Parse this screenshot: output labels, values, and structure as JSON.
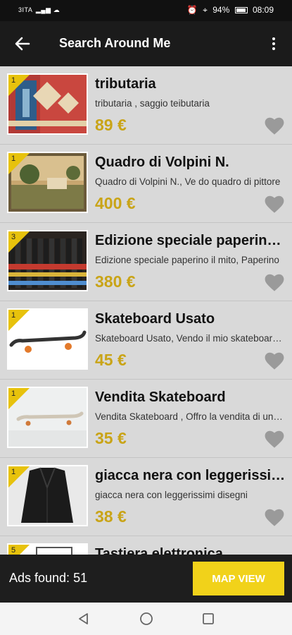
{
  "status": {
    "carrier": "3ITA",
    "battery": "94%",
    "time": "08:09"
  },
  "header": {
    "title": "Search Around Me"
  },
  "listings": [
    {
      "badge": "1",
      "title": "tributaria",
      "description": "tributaria , saggio teibutaria",
      "price": "89 €",
      "image": "rug-photo"
    },
    {
      "badge": "1",
      "title": "Quadro di Volpini N.",
      "description": "Quadro di Volpini N., Ve do quadro di pittore",
      "price": "400 €",
      "image": "painting-photo"
    },
    {
      "badge": "3",
      "title": "Edizione speciale paperino il mito",
      "description": "Edizione speciale paperino il mito, Paperino",
      "price": "380 €",
      "image": "book-collection-photo"
    },
    {
      "badge": "1",
      "title": "Skateboard Usato",
      "description": "Skateboard Usato, Vendo il mio skateboard usato",
      "price": "45 €",
      "image": "skateboard-photo"
    },
    {
      "badge": "1",
      "title": "Vendita Skateboard",
      "description": "Vendita Skateboard , Offro la vendita di uno skateboard",
      "price": "35 €",
      "image": "longboard-photo"
    },
    {
      "badge": "1",
      "title": "giacca nera con leggerissimi disegni",
      "description": "giacca nera con leggerissimi  disegni",
      "price": "38 €",
      "image": "jacket-photo"
    },
    {
      "badge": "5",
      "title": "Tastiera elettronica",
      "description": "",
      "price": "",
      "image": "keyboard-photo"
    }
  ],
  "footer": {
    "ads_found": "Ads found: 51",
    "map_view": "MAP VIEW"
  },
  "colors": {
    "accent": "#f1d21a",
    "price": "#c9a417",
    "app_bar": "#1b1b1b"
  },
  "icons": [
    "back-arrow-icon",
    "more-vert-icon",
    "heart-icon",
    "nav-back-icon",
    "nav-home-icon",
    "nav-recents-icon"
  ]
}
